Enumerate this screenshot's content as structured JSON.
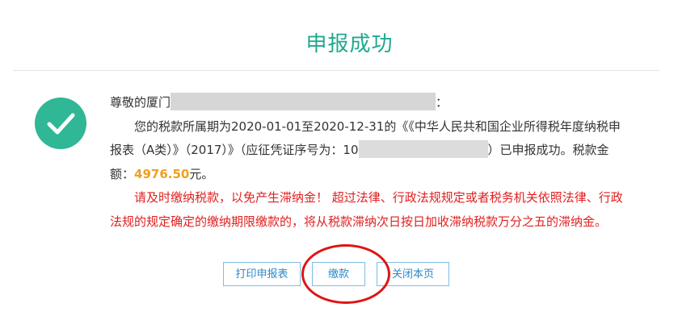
{
  "page": {
    "title": "申报成功"
  },
  "message": {
    "greeting_prefix": "尊敬的厦门",
    "greeting_suffix": "：",
    "line1": "您的税款所属期为2020-01-01至2020-12-31的《《中华人民共和国企业所得税年度纳税申",
    "line2_prefix": "报表（A类）》（2017）》（应征凭证序号为：10",
    "line2_suffix": "）已申报成功。税款金",
    "line3_prefix": "额：",
    "amount": "4976.50",
    "line3_suffix": "元。",
    "warning1": "请及时缴纳税款，以免产生滞纳金！ 超过法律、行政法规规定或者税务机关依照法律、行政",
    "warning2": "法规的规定确定的缴纳期限缴款的，将从税款滞纳次日按日加收滞纳税款万分之五的滞纳金。"
  },
  "buttons": {
    "print": "打印申报表",
    "pay": "缴款",
    "close": "关闭本页"
  },
  "colors": {
    "title": "#1fa98f",
    "check_circle": "#2fb796",
    "amount": "#f0a01e",
    "warning": "#e02020",
    "button_border": "#7fbde3",
    "button_text": "#2a89c8",
    "annotation_ring": "#e01414"
  },
  "icons": {
    "status": "check-icon"
  }
}
